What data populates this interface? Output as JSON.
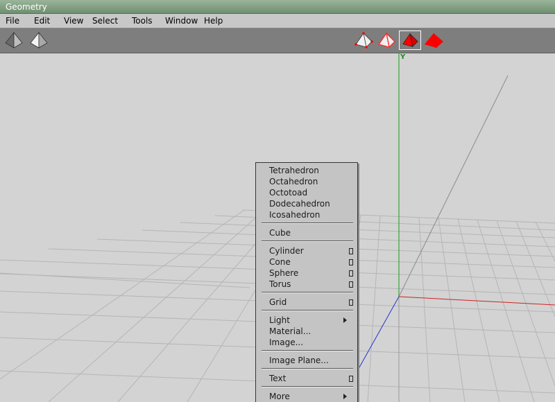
{
  "window": {
    "title": "Geometry"
  },
  "menubar": {
    "items": [
      {
        "id": "file",
        "label": "File"
      },
      {
        "id": "edit",
        "label": "Edit"
      },
      {
        "id": "view",
        "label": "View"
      },
      {
        "id": "select",
        "label": "Select"
      },
      {
        "id": "tools",
        "label": "Tools"
      },
      {
        "id": "window",
        "label": "Window"
      },
      {
        "id": "help",
        "label": "Help"
      }
    ]
  },
  "toolbar": {
    "left_icons": [
      "shaded-pyramid-icon",
      "white-pyramid-icon"
    ],
    "right_icons": [
      "vertex-select-icon",
      "edge-select-icon",
      "face-select-icon",
      "body-select-icon"
    ],
    "selected_icon": "face-select-icon",
    "accent": "#ff0000"
  },
  "viewport": {
    "y_axis_label": "Y",
    "colors": {
      "y_axis": "#1a9a1a",
      "x_axis": "#cc2222",
      "z_axis": "#2233cc",
      "grid": "#b8b8b8"
    }
  },
  "popup_menu": {
    "items": [
      {
        "label": "Tetrahedron"
      },
      {
        "label": "Octahedron"
      },
      {
        "label": "Octotoad"
      },
      {
        "label": "Dodecahedron"
      },
      {
        "label": "Icosahedron"
      },
      {
        "label": "Cube"
      },
      {
        "label": "Cylinder",
        "option": true
      },
      {
        "label": "Cone",
        "option": true
      },
      {
        "label": "Sphere",
        "option": true
      },
      {
        "label": "Torus",
        "option": true
      },
      {
        "label": "Grid",
        "option": true
      },
      {
        "label": "Light",
        "submenu": true
      },
      {
        "label": "Material..."
      },
      {
        "label": "Image..."
      },
      {
        "label": "Image Plane..."
      },
      {
        "label": "Text",
        "option": true
      },
      {
        "label": "More",
        "submenu": true
      }
    ]
  }
}
